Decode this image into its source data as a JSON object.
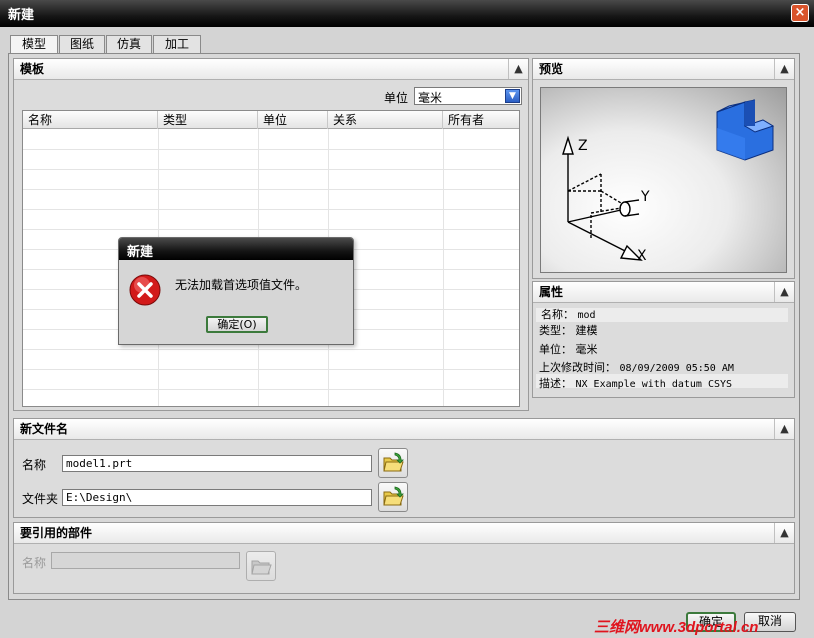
{
  "window": {
    "title": "新建",
    "close_glyph": "×"
  },
  "tabs": [
    {
      "label": "模型"
    },
    {
      "label": "图纸"
    },
    {
      "label": "仿真"
    },
    {
      "label": "加工"
    }
  ],
  "template": {
    "header": "模板",
    "unit_label": "单位",
    "unit_value": "毫米",
    "columns": [
      "名称",
      "类型",
      "单位",
      "关系",
      "所有者"
    ]
  },
  "preview": {
    "header": "预览",
    "axis_x": "X",
    "axis_y": "Y",
    "axis_z": "Z"
  },
  "properties": {
    "header": "属性",
    "rows": [
      {
        "label": "名称：",
        "value": "mod"
      },
      {
        "label": "类型：",
        "value": "建模"
      },
      {
        "label": "单位：",
        "value": "毫米"
      },
      {
        "label": "上次修改时间：",
        "value": "08/09/2009 05:50 AM"
      },
      {
        "label": "描述：",
        "value": "NX Example with datum CSYS"
      }
    ]
  },
  "new_file": {
    "header": "新文件名",
    "name_label": "名称",
    "name_value": "model1.prt",
    "folder_label": "文件夹",
    "folder_value": "E:\\Design\\"
  },
  "referenced": {
    "header": "要引用的部件",
    "name_label": "名称",
    "name_value": ""
  },
  "footer": {
    "ok_label": "确定",
    "cancel_label": "取消",
    "watermark": "三维网www.3dportal.cn"
  },
  "dialog": {
    "title": "新建",
    "message": "无法加载首选项值文件。",
    "ok_label": "确定(O)"
  },
  "colors": {
    "error_red": "#d21a1a",
    "watermark_red": "#e0141e",
    "cube_blue": "#2a6fe0"
  }
}
